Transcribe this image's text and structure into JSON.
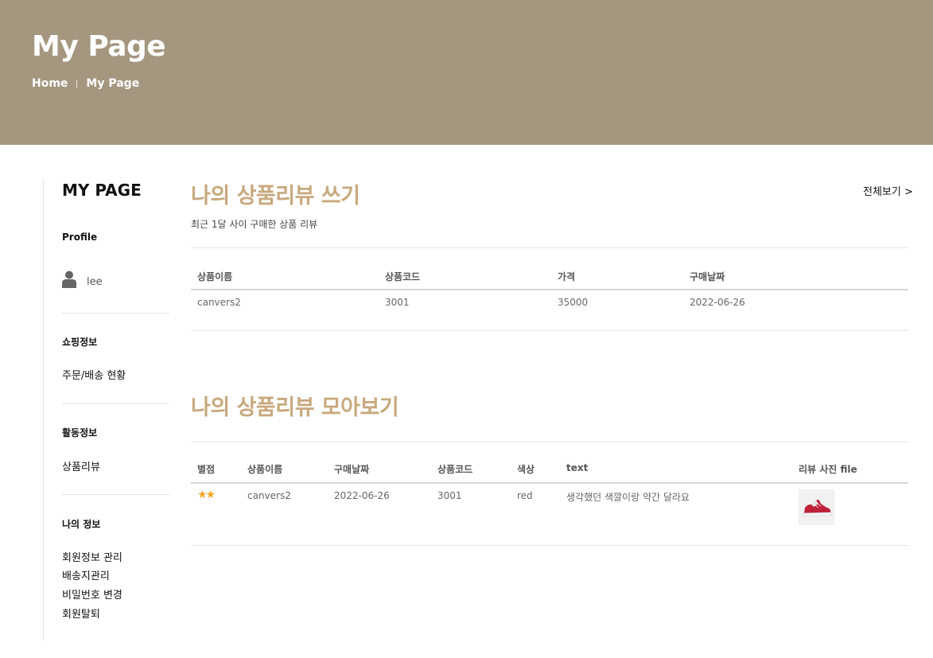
{
  "hero": {
    "title": "My Page",
    "breadcrumb": [
      "Home",
      "My Page"
    ]
  },
  "sidebar": {
    "title": "MY PAGE",
    "profile_heading": "Profile",
    "user_name": "lee",
    "shopping_heading": "쇼핑정보",
    "shopping_items": [
      "주문/배송 현황"
    ],
    "activity_heading": "활동정보",
    "activity_items": [
      "상품리뷰"
    ],
    "myinfo_heading": "나의 정보",
    "myinfo_items": [
      "회원정보 관리",
      "배송지관리",
      "비밀번호 변경",
      "회원탈퇴"
    ]
  },
  "write_review": {
    "title": "나의 상품리뷰 쓰기",
    "subtitle": "최근 1달 사이 구매한 상품 리뷰",
    "view_all": "전체보기 >",
    "columns": [
      "상품이름",
      "상품코드",
      "가격",
      "구매날짜"
    ],
    "rows": [
      [
        "canvers2",
        "3001",
        "35000",
        "2022-06-26"
      ]
    ]
  },
  "review_list": {
    "title": "나의 상품리뷰 모아보기",
    "columns": [
      "별점",
      "상품이름",
      "구매날짜",
      "상품코드",
      "색상",
      "text",
      "리뷰 사진 file"
    ],
    "rows": [
      {
        "rating": 2,
        "stars": "★★",
        "name": "canvers2",
        "date": "2022-06-26",
        "code": "3001",
        "color": "red",
        "text": "생각했던 색깔이랑 약간 달라요",
        "photo_icon": "red-sneaker-icon"
      }
    ]
  },
  "colors": {
    "hero_bg": "#a59680",
    "accent": "#c8a97e",
    "star": "#f5a623"
  }
}
